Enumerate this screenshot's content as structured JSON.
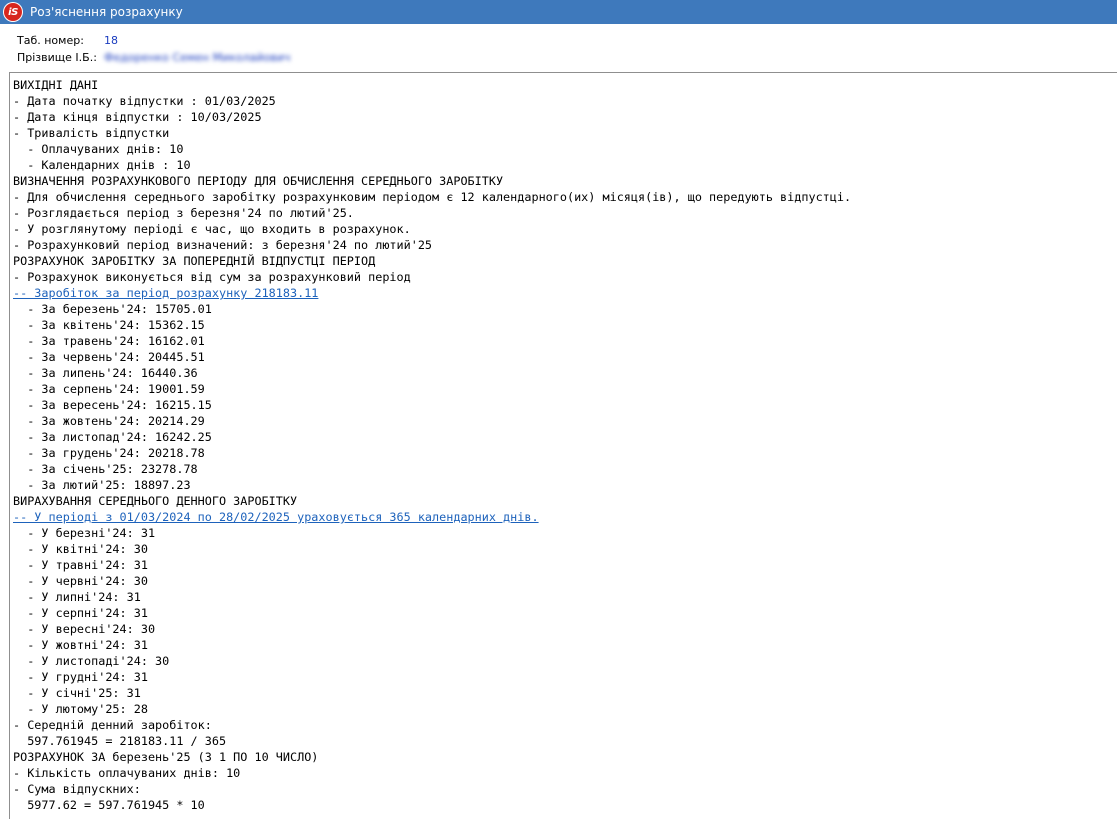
{
  "window": {
    "title": "Роз'яснення розрахунку",
    "icon_text": "iS"
  },
  "employee": {
    "tab_label": "Таб. номер:",
    "tab_value": "18",
    "name_label": "Прізвище І.Б.:",
    "name_value": "Федоренко Семен Миколайович"
  },
  "report": {
    "lines": [
      {
        "text": "ВИХІДНІ ДАНІ",
        "link": false
      },
      {
        "text": "- Дата початку відпустки : 01/03/2025",
        "link": false
      },
      {
        "text": "- Дата кінця відпустки : 10/03/2025",
        "link": false
      },
      {
        "text": "- Тривалість відпустки",
        "link": false
      },
      {
        "text": "  - Оплачуваних днів: 10",
        "link": false
      },
      {
        "text": "  - Календарних днів : 10",
        "link": false
      },
      {
        "text": "ВИЗНАЧЕННЯ РОЗРАХУНКОВОГО ПЕРІОДУ ДЛЯ ОБЧИСЛЕННЯ СЕРЕДНЬОГО ЗАРОБІТКУ",
        "link": false
      },
      {
        "text": "- Для обчислення середнього заробітку розрахунковим періодом є 12 календарного(их) місяця(ів), що передують відпустці.",
        "link": false
      },
      {
        "text": "- Розглядається період з березня'24 по лютий'25.",
        "link": false
      },
      {
        "text": "- У розглянутому періоді є час, що входить в розрахунок.",
        "link": false
      },
      {
        "text": "- Розрахунковий період визначений: з березня'24 по лютий'25",
        "link": false
      },
      {
        "text": "РОЗРАХУНОК ЗАРОБІТКУ ЗА ПОПЕРЕДНІЙ ВІДПУСТЦІ ПЕРІОД",
        "link": false
      },
      {
        "text": "- Розрахунок виконується від сум за розрахунковий період",
        "link": false
      },
      {
        "text": "-- Заробіток за період розрахунку 218183.11",
        "link": true
      },
      {
        "text": "  - За березень'24: 15705.01",
        "link": false
      },
      {
        "text": "  - За квітень'24: 15362.15",
        "link": false
      },
      {
        "text": "  - За травень'24: 16162.01",
        "link": false
      },
      {
        "text": "  - За червень'24: 20445.51",
        "link": false
      },
      {
        "text": "  - За липень'24: 16440.36",
        "link": false
      },
      {
        "text": "  - За серпень'24: 19001.59",
        "link": false
      },
      {
        "text": "  - За вересень'24: 16215.15",
        "link": false
      },
      {
        "text": "  - За жовтень'24: 20214.29",
        "link": false
      },
      {
        "text": "  - За листопад'24: 16242.25",
        "link": false
      },
      {
        "text": "  - За грудень'24: 20218.78",
        "link": false
      },
      {
        "text": "  - За січень'25: 23278.78",
        "link": false
      },
      {
        "text": "  - За лютий'25: 18897.23",
        "link": false
      },
      {
        "text": "ВИРАХУВАННЯ СЕРЕДНЬОГО ДЕННОГО ЗАРОБІТКУ",
        "link": false
      },
      {
        "text": "-- У періоді з 01/03/2024 по 28/02/2025 ураховується 365 календарних днів.",
        "link": true
      },
      {
        "text": "  - У березні'24: 31",
        "link": false
      },
      {
        "text": "  - У квітні'24: 30",
        "link": false
      },
      {
        "text": "  - У травні'24: 31",
        "link": false
      },
      {
        "text": "  - У червні'24: 30",
        "link": false
      },
      {
        "text": "  - У липні'24: 31",
        "link": false
      },
      {
        "text": "  - У серпні'24: 31",
        "link": false
      },
      {
        "text": "  - У вересні'24: 30",
        "link": false
      },
      {
        "text": "  - У жовтні'24: 31",
        "link": false
      },
      {
        "text": "  - У листопаді'24: 30",
        "link": false
      },
      {
        "text": "  - У грудні'24: 31",
        "link": false
      },
      {
        "text": "  - У січні'25: 31",
        "link": false
      },
      {
        "text": "  - У лютому'25: 28",
        "link": false
      },
      {
        "text": "- Середній денний заробіток:",
        "link": false
      },
      {
        "text": "  597.761945 = 218183.11 / 365",
        "link": false
      },
      {
        "text": "РОЗРАХУНОК ЗА березень'25 (З 1 ПО 10 ЧИСЛО)",
        "link": false
      },
      {
        "text": "- Кількість оплачуваних днів: 10",
        "link": false
      },
      {
        "text": "- Сума відпускних:",
        "link": false
      },
      {
        "text": "  5977.62 = 597.761945 * 10",
        "link": false
      }
    ]
  },
  "colors": {
    "titlebar": "#3e79bc",
    "link": "#1d62bb",
    "value": "#1a3cbf"
  }
}
